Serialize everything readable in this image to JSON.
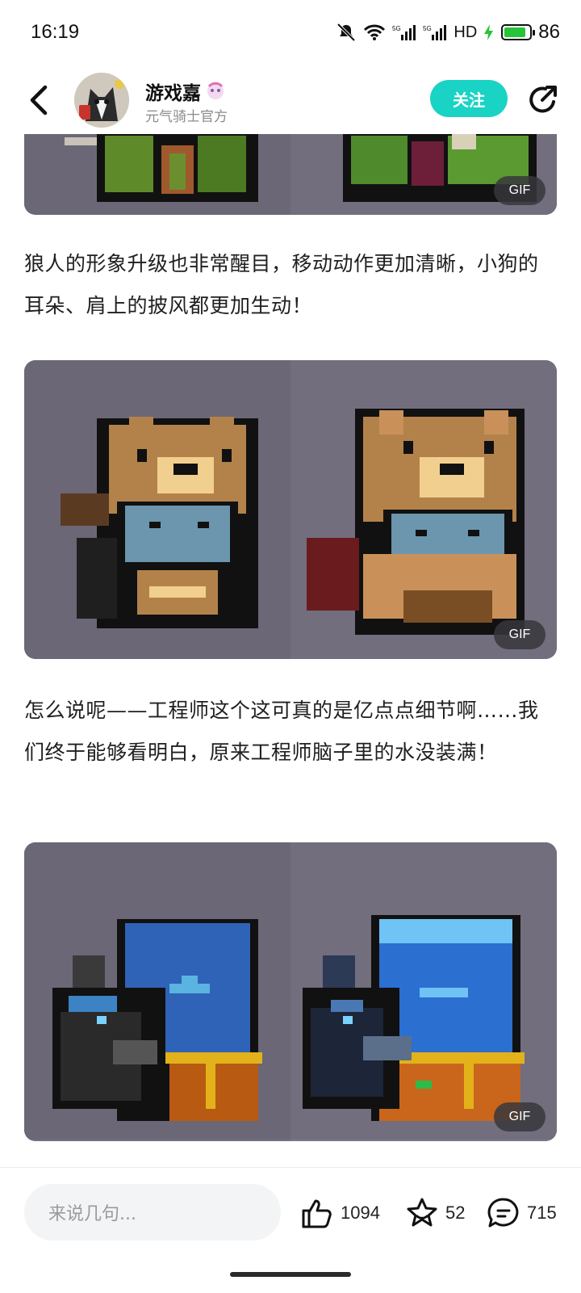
{
  "status_bar": {
    "time": "16:19",
    "network_label": "HD",
    "battery_percent": "86",
    "battery_level": 0.86
  },
  "header": {
    "author_name": "游戏嘉",
    "author_subtitle": "元气骑士官方",
    "follow_label": "关注"
  },
  "content": {
    "gif_label": "GIF",
    "paragraphs": [
      "狼人的形象升级也非常醒目，移动动作更加清晰，小狗的耳朵、肩上的披风都更加生动！",
      "怎么说呢——工程师这个这可真的是亿点点细节啊……我们终于能够看明白，原来工程师脑子里的水没装满！"
    ]
  },
  "bottom_bar": {
    "comment_placeholder": "来说几句...",
    "like_count": "1094",
    "favorite_count": "52",
    "comment_count": "715"
  },
  "colors": {
    "accent": "#19d3c5",
    "media_bg": "#706c7b",
    "battery_green": "#27c43a"
  },
  "icons": [
    "back-icon",
    "share-icon",
    "thumbs-up-icon",
    "star-icon",
    "comment-icon",
    "mute-icon",
    "wifi-icon",
    "signal-icon",
    "battery-icon"
  ]
}
